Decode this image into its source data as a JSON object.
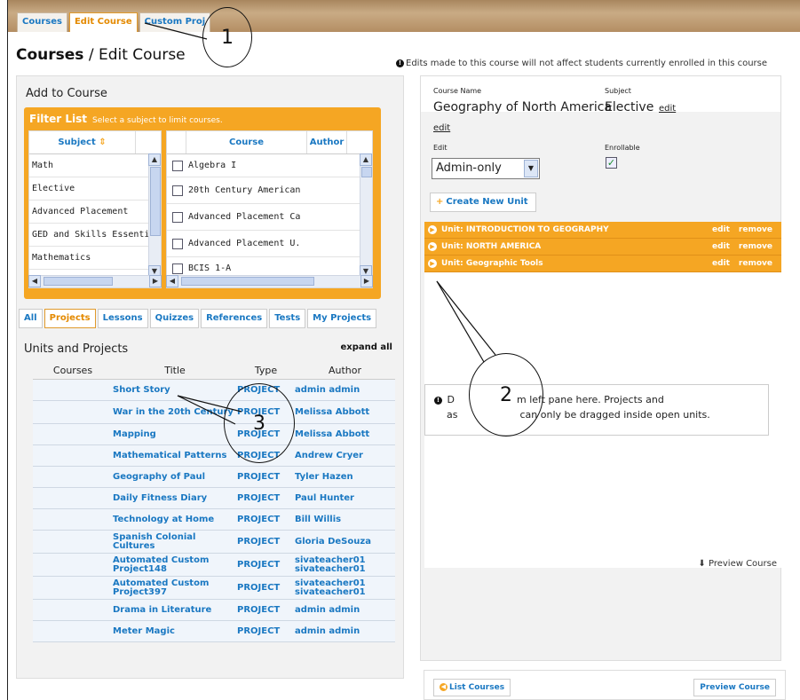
{
  "tabs": [
    "Courses",
    "Edit Course",
    "Custom Proj"
  ],
  "page_title": {
    "bold": "Courses",
    "rest": " / Edit Course"
  },
  "notice": "Edits made to this course will not affect students currently enrolled in this course",
  "add_to_course": {
    "title": "Add to Course",
    "filter_title": "Filter List",
    "filter_hint": "Select a subject to limit courses.",
    "subject_header": "Subject",
    "sort_icon": "sort-arrows-icon",
    "subjects": [
      "Math",
      "Elective",
      "Advanced Placement",
      "GED and  Skills Essenti",
      "Mathematics"
    ],
    "course_header": "Course",
    "author_header": "Author",
    "courses": [
      "Algebra I",
      "20th Century American",
      "Advanced Placement Ca",
      "Advanced Placement U.",
      "BCIS 1-A"
    ]
  },
  "category_tabs": [
    "All",
    "Projects",
    "Lessons",
    "Quizzes",
    "References",
    "Tests",
    "My Projects"
  ],
  "units_projects": {
    "title": "Units and Projects",
    "expand_all": "expand all",
    "columns": [
      "Courses",
      "Title",
      "Type",
      "Author"
    ],
    "rows": [
      {
        "title": "Short Story",
        "type": "PROJECT",
        "author": "admin admin"
      },
      {
        "title": "War in the 20th Century",
        "type": "PROJECT",
        "author": "Melissa Abbott"
      },
      {
        "title": "Mapping",
        "type": "PROJECT",
        "author": "Melissa Abbott"
      },
      {
        "title": "Mathematical Patterns",
        "type": "PROJECT",
        "author": "Andrew Cryer"
      },
      {
        "title": "Geography of Paul",
        "type": "PROJECT",
        "author": "Tyler Hazen"
      },
      {
        "title": "Daily Fitness Diary",
        "type": "PROJECT",
        "author": "Paul Hunter"
      },
      {
        "title": "Technology at Home",
        "type": "PROJECT",
        "author": "Bill Willis"
      },
      {
        "title": "Spanish Colonial Cultures",
        "type": "PROJECT",
        "author": "Gloria DeSouza"
      },
      {
        "title": "Automated Custom Project148",
        "type": "PROJECT",
        "author": "sivateacher01 sivateacher01"
      },
      {
        "title": "Automated Custom Project397",
        "type": "PROJECT",
        "author": "sivateacher01 sivateacher01"
      },
      {
        "title": "Drama in Literature",
        "type": "PROJECT",
        "author": "admin admin"
      },
      {
        "title": "Meter Magic",
        "type": "PROJECT",
        "author": "admin admin"
      }
    ]
  },
  "course_detail": {
    "course_name_label": "Course Name",
    "course_name": "Geography of North America",
    "subject_label": "Subject",
    "subject": "Elective",
    "edit_link": "edit",
    "edit_label": "Edit",
    "edit_value": "Admin-only",
    "enrollable_label": "Enrollable",
    "enrollable_checked": true,
    "create_unit": "Create New Unit",
    "units": [
      {
        "name": "Unit:  INTRODUCTION TO GEOGRAPHY",
        "edit": "edit",
        "remove": "remove"
      },
      {
        "name": "Unit:  NORTH AMERICA",
        "edit": "edit",
        "remove": "remove"
      },
      {
        "name": "Unit:  Geographic Tools",
        "edit": "edit",
        "remove": "remove"
      }
    ],
    "drop_line1_a": "D",
    "drop_line1_b": "m left pane here. Projects and",
    "drop_line2_a": "as",
    "drop_line2_b": "can only be dragged inside open units.",
    "preview_link": "Preview Course"
  },
  "bottom": {
    "list_courses": "List Courses",
    "preview_course": "Preview Course"
  },
  "callouts": [
    "1",
    "2",
    "3"
  ],
  "colors": {
    "accent_orange": "#f5a623",
    "link_blue": "#1a78c2"
  }
}
